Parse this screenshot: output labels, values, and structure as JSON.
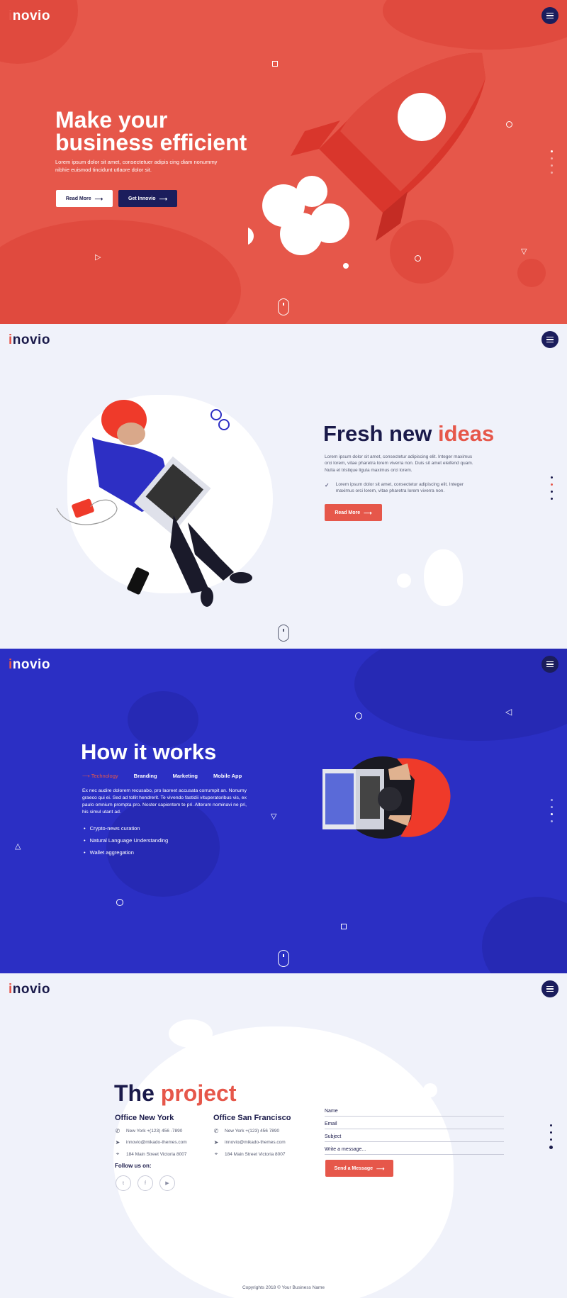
{
  "brand": {
    "logo_prefix": "i",
    "logo_rest": "novio",
    "accent": "#e6574a",
    "dark": "#1a1a4a",
    "blue": "#2b2fc4"
  },
  "hero": {
    "title_line1": "Make your",
    "title_line2": "business efficient",
    "text": "Lorem ipsum dolor sit amet, consectetuer adipis cing diam nonummy nibhie euismod tincidunt utlaore dolor sit.",
    "btn_read_more": "Read More",
    "btn_get": "Get Innovio"
  },
  "ideas": {
    "title_a": "Fresh new",
    "title_b": "ideas",
    "text": "Lorem ipsum dolor sit amet, consectetur adipiscing elit. Integer maximus orci lorem, vitae pharetra lorem viverra non. Duis sit amet eleifend quam. Nulla et tristique ligula maximus orci lorem.",
    "check_text": "Lorem ipsum dolor sit amet, consectetur adipiscing elit. Integer maximus orci lorem, vitae pharetra lorem viverra non.",
    "btn": "Read More"
  },
  "works": {
    "title": "How it works",
    "tabs": [
      "Technology",
      "Branding",
      "Marketing",
      "Mobile App"
    ],
    "text": "Ex nec audire dolorem recusabo, pro laoreet accusata corrumpit an. Nonumy graeco qui ei. Sed ad tollit hendrerit. Te vivendo fastidii vituperatoribus vis, ex paulo omnium prompta pro. Noster sapientem te pri. Alterum nominavi ne pri, his simul utant ad.",
    "bullets": [
      "Crypto-news curation",
      "Natural Language Understanding",
      "Wallet aggregation"
    ]
  },
  "project": {
    "title_a": "The",
    "title_b": "project",
    "offices": [
      {
        "name": "Office New York",
        "phone": "New York +(123) 456 -7890",
        "email": "innovio@mikado-themes.com",
        "address": "184 Main Street Victoria 8007"
      },
      {
        "name": "Office San Francisco",
        "phone": "New York +(123) 456 7890",
        "email": "innovio@mikado-themes.com",
        "address": "184 Main Street Victoria 8007"
      }
    ],
    "follow": "Follow us on:",
    "form": {
      "name": "Name",
      "email": "Email",
      "subject": "Subject",
      "message": "Write a message...",
      "send": "Send a Message"
    },
    "copyright": "Copyrights 2018 © Your Business Name"
  },
  "icons": {
    "menu": "hamburger-icon",
    "arrow": "arrow-right-icon",
    "check": "check-icon",
    "phone": "phone-icon",
    "send": "paper-plane-icon",
    "pin": "location-pin-icon",
    "twitter": "twitter-icon",
    "facebook": "facebook-icon",
    "youtube": "youtube-icon"
  }
}
